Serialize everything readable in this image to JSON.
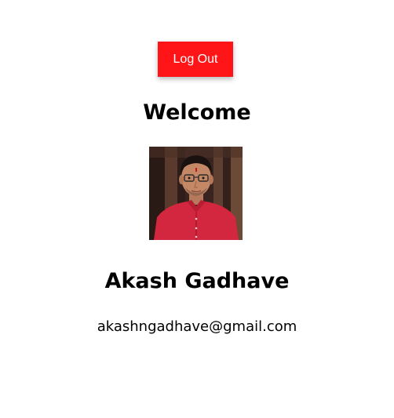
{
  "header": {
    "logout_label": "Log Out",
    "welcome_text": "Welcome"
  },
  "profile": {
    "avatar_icon": "user-photo",
    "name": "Akash Gadhave",
    "email": "akashngadhave@gmail.com"
  },
  "colors": {
    "logout_button": "#ff1418",
    "logout_text": "#ffffff",
    "background": "#ffffff",
    "text": "#000000"
  }
}
